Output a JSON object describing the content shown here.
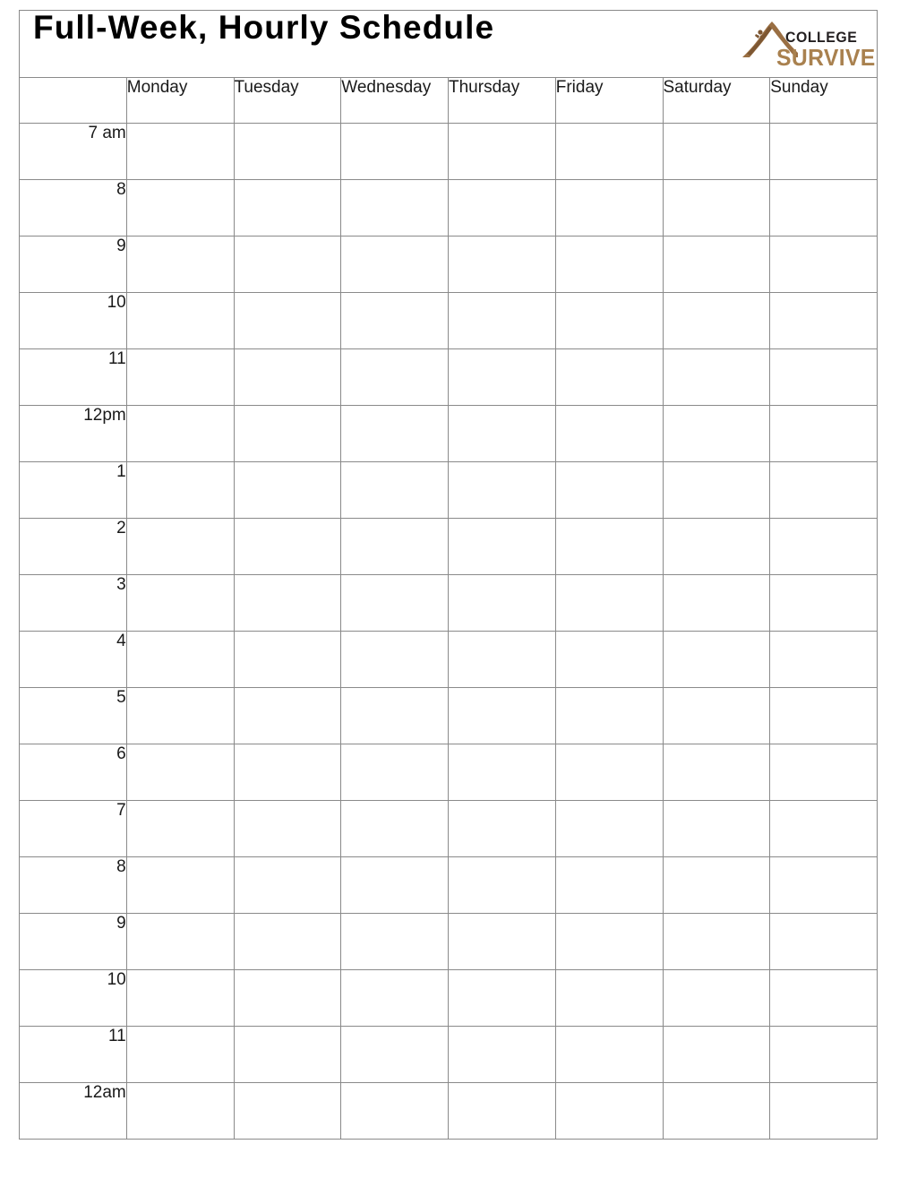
{
  "document": {
    "title": "Full-Week, Hourly Schedule"
  },
  "logo": {
    "mark_name": "mountain-climber-icon",
    "line1": "COLLEGE",
    "line2": "SURVIVE",
    "color_line1": "#231f20",
    "color_line2": "#a9814f",
    "mark_color": "#9a6f43"
  },
  "table": {
    "corner_label": "",
    "day_columns": [
      "Monday",
      "Tuesday",
      "Wednesday",
      "Thursday",
      "Friday",
      "Saturday",
      "Sunday"
    ],
    "time_rows": [
      "7 am",
      "8",
      "9",
      "10",
      "11",
      "12pm",
      "1",
      "2",
      "3",
      "4",
      "5",
      "6",
      "7",
      "8",
      "9",
      "10",
      "11",
      "12am"
    ],
    "grid_color": "#8a8a8a",
    "background_color": "#ffffff"
  }
}
